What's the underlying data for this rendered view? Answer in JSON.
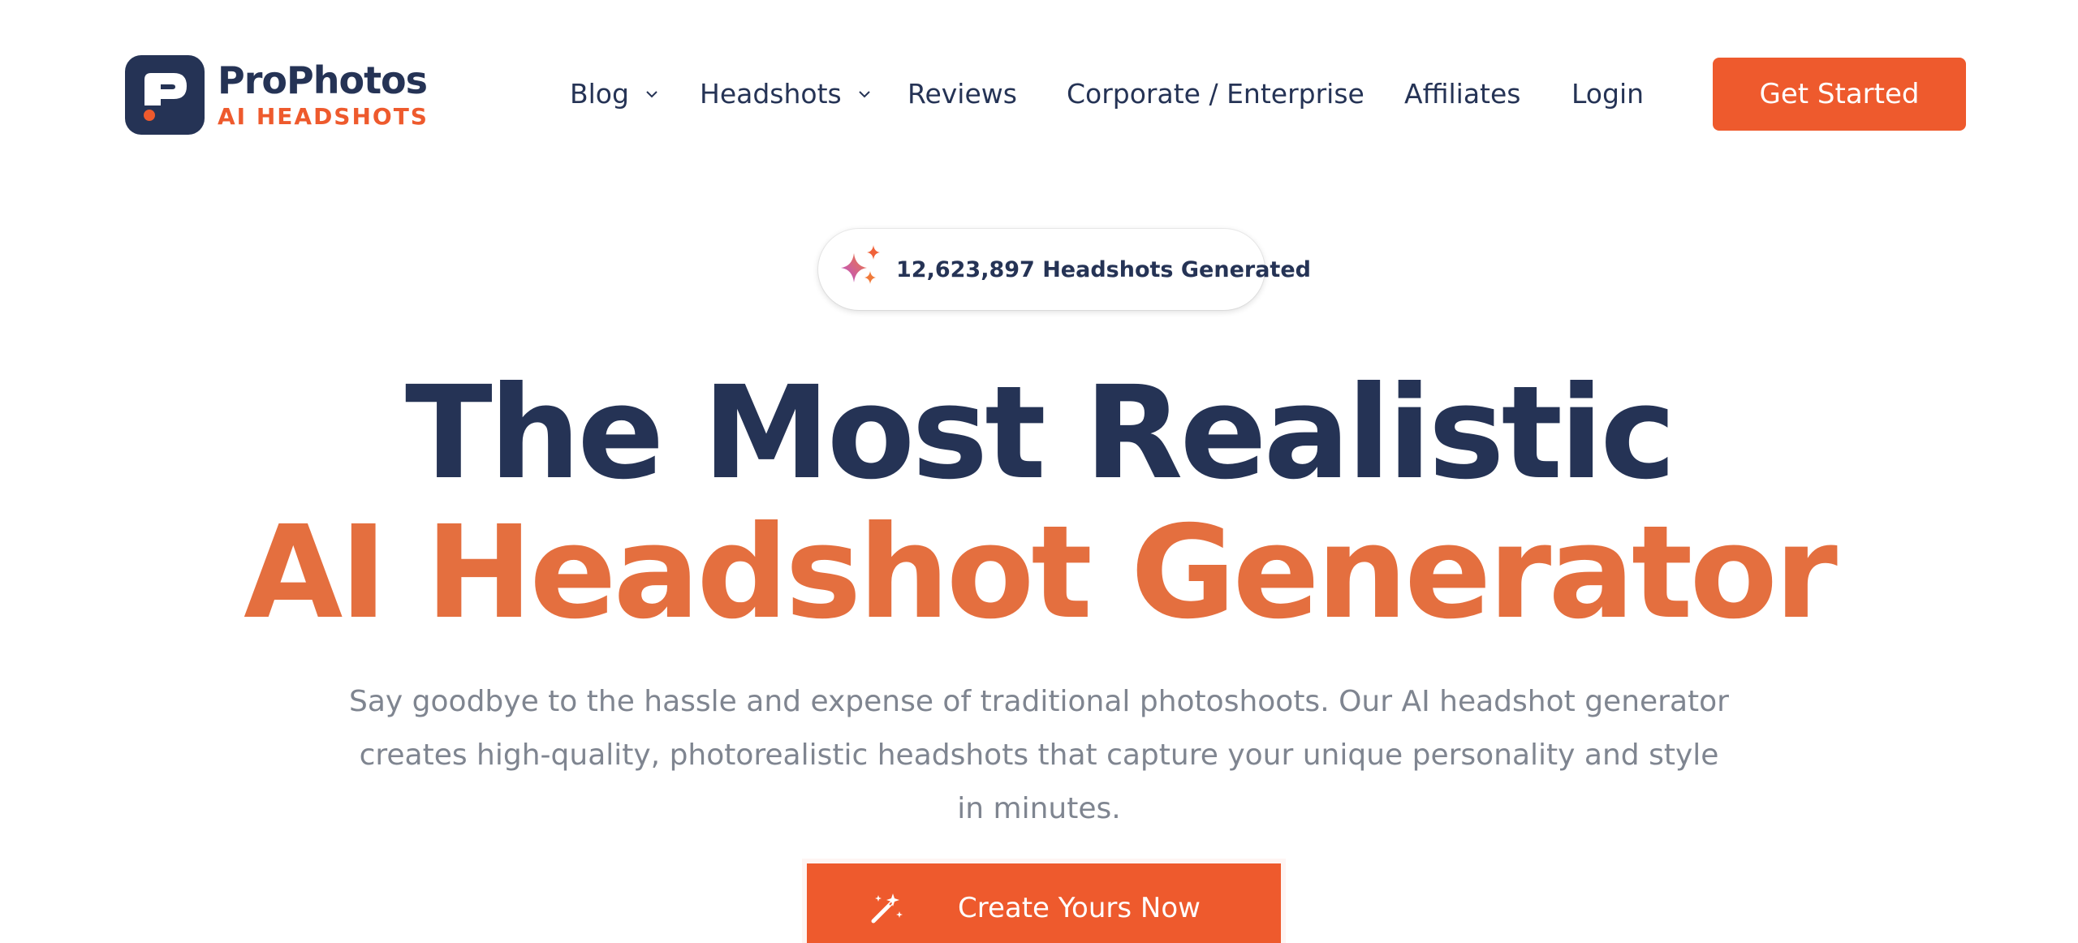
{
  "brand": {
    "name": "ProPhotos",
    "tagline": "AI HEADSHOTS",
    "logo_icon": "prophotos-logo-icon"
  },
  "nav": {
    "items": [
      {
        "label": "Blog",
        "has_dropdown": true
      },
      {
        "label": "Headshots",
        "has_dropdown": true
      },
      {
        "label": "Reviews",
        "has_dropdown": false
      },
      {
        "label": "Corporate / Enterprise",
        "has_dropdown": false
      },
      {
        "label": "Affiliates",
        "has_dropdown": false
      },
      {
        "label": "Login",
        "has_dropdown": false
      }
    ],
    "cta_label": "Get Started"
  },
  "counter": {
    "icon": "sparkles-icon",
    "text": "12,623,897 Headshots Generated"
  },
  "hero": {
    "title_line_1": "The Most Realistic",
    "title_line_2": "AI Headshot Generator",
    "description": "Say goodbye to the hassle and expense of traditional photoshoots. Our AI headshot generator creates high-quality, photorealistic headshots that capture your unique personality and style in minutes.",
    "cta_label": "Create Yours Now",
    "cta_icon": "magic-wand-icon"
  },
  "colors": {
    "navy": "#253355",
    "accent_orange": "#ee5a2d",
    "title_orange": "#e46f3f",
    "muted_text": "#7f8590"
  }
}
